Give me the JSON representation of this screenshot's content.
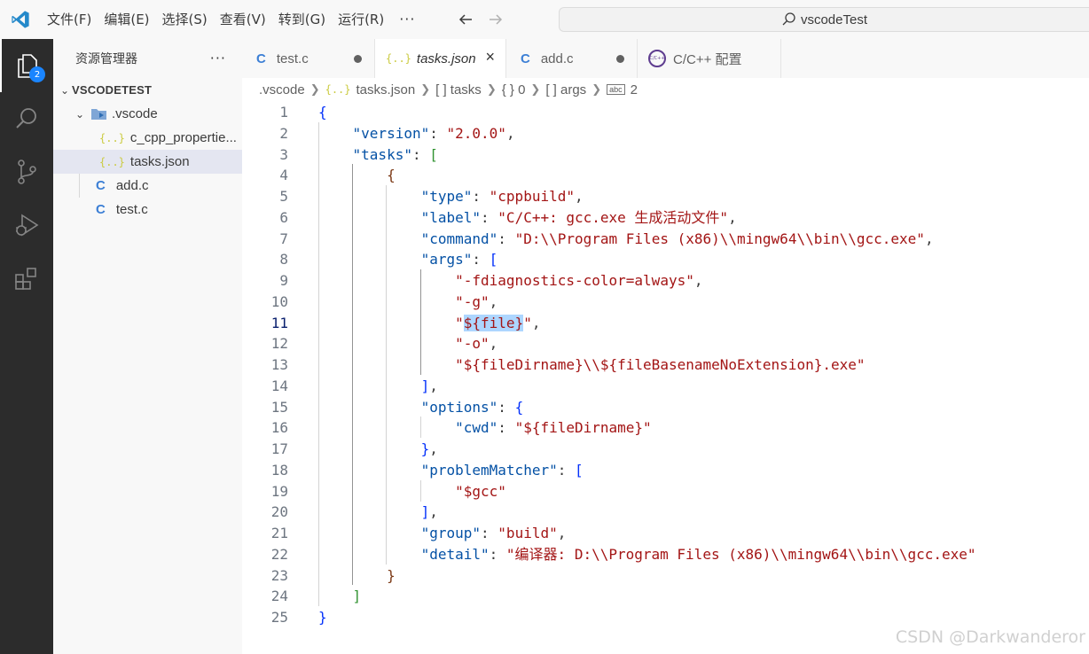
{
  "menu": [
    "文件(F)",
    "编辑(E)",
    "选择(S)",
    "查看(V)",
    "转到(G)",
    "运行(R)"
  ],
  "menu_more": "···",
  "search": "vscodeTest",
  "activity": {
    "explorer_badge": "2"
  },
  "sidebar": {
    "title": "资源管理器",
    "more": "···",
    "root": "VSCODETEST",
    "folder": ".vscode",
    "files": [
      {
        "name": "c_cpp_propertie...",
        "icon": "{..}"
      },
      {
        "name": "tasks.json",
        "icon": "{..}"
      },
      {
        "name": "add.c",
        "icon": "C"
      },
      {
        "name": "test.c",
        "icon": "C"
      }
    ]
  },
  "tabs": [
    {
      "label": "test.c",
      "icon": "C"
    },
    {
      "label": "tasks.json",
      "icon": "{..}"
    },
    {
      "label": "add.c",
      "icon": "C"
    },
    {
      "label": "C/C++ 配置",
      "icon": "C/C++"
    }
  ],
  "breadcrumb": [
    ".vscode",
    "tasks.json",
    "[ ] tasks",
    "{ } 0",
    "[ ] args",
    "2"
  ],
  "code": {
    "l1": "{",
    "l2_key": "\"version\"",
    "l2_val": "\"2.0.0\"",
    "l3_key": "\"tasks\"",
    "l3_open": "[",
    "l4": "{",
    "l5_key": "\"type\"",
    "l5_val": "\"cppbuild\"",
    "l6_key": "\"label\"",
    "l6_val": "\"C/C++: gcc.exe 生成活动文件\"",
    "l7_key": "\"command\"",
    "l7_val": "\"D:\\\\Program Files (x86)\\\\mingw64\\\\bin\\\\gcc.exe\"",
    "l8_key": "\"args\"",
    "l8_open": "[",
    "l9": "\"-fdiagnostics-color=always\"",
    "l10": "\"-g\"",
    "l11_q1": "\"",
    "l11_mid": "${file}",
    "l11_q2": "\"",
    "l12": "\"-o\"",
    "l13": "\"${fileDirname}\\\\${fileBasenameNoExtension}.exe\"",
    "l14": "]",
    "l15_key": "\"options\"",
    "l15_open": "{",
    "l16_key": "\"cwd\"",
    "l16_val": "\"${fileDirname}\"",
    "l17": "}",
    "l18_key": "\"problemMatcher\"",
    "l18_open": "[",
    "l19": "\"$gcc\"",
    "l20": "]",
    "l21_key": "\"group\"",
    "l21_val": "\"build\"",
    "l22_key": "\"detail\"",
    "l22_val": "\"编译器: D:\\\\Program Files (x86)\\\\mingw64\\\\bin\\\\gcc.exe\"",
    "l23": "}",
    "l24": "]",
    "l25": "}"
  },
  "watermark": "CSDN @Darkwanderor"
}
